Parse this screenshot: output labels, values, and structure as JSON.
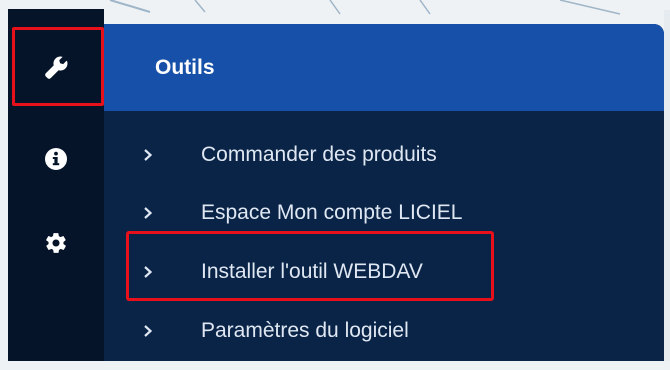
{
  "rail": {
    "items": [
      {
        "icon": "wrench-icon",
        "active": true
      },
      {
        "icon": "info-icon",
        "active": false
      },
      {
        "icon": "gear-icon",
        "active": false
      }
    ]
  },
  "panel": {
    "title": "Outils",
    "items": [
      {
        "label": "Commander des produits"
      },
      {
        "label": "Espace Mon compte LICIEL"
      },
      {
        "label": "Installer l'outil WEBDAV"
      },
      {
        "label": "Paramètres du logiciel"
      }
    ]
  },
  "colors": {
    "rail_bg": "#051428",
    "panel_bg": "#0a2447",
    "header_bg": "#1650a8",
    "highlight": "#e8101a",
    "text": "#dfe7f2"
  }
}
